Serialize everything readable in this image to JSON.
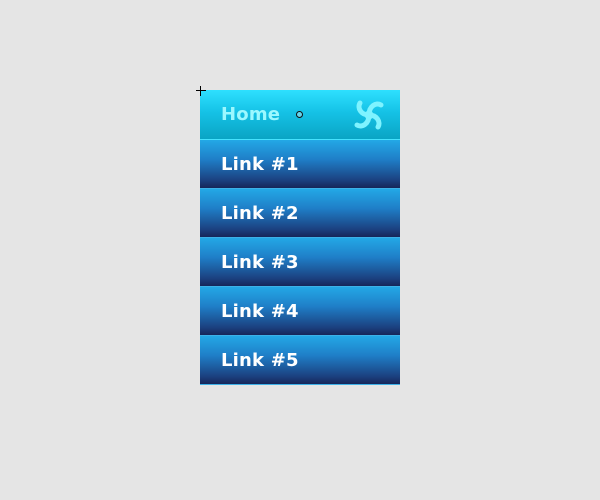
{
  "menu": {
    "home": {
      "label": "Home",
      "icon": "swirl-logo-icon"
    },
    "links": [
      {
        "label": "Link #1"
      },
      {
        "label": "Link #2"
      },
      {
        "label": "Link #3"
      },
      {
        "label": "Link #4"
      },
      {
        "label": "Link #5"
      }
    ]
  },
  "colors": {
    "background": "#e5e5e5",
    "home_gradient_top": "#2ee0ff",
    "home_gradient_bottom": "#0aa4c4",
    "home_text": "#9cf8ff",
    "link_gradient_top": "#23a8e6",
    "link_gradient_bottom": "#16265a",
    "link_text": "#ffffff",
    "logo": "#7ff3ff"
  }
}
